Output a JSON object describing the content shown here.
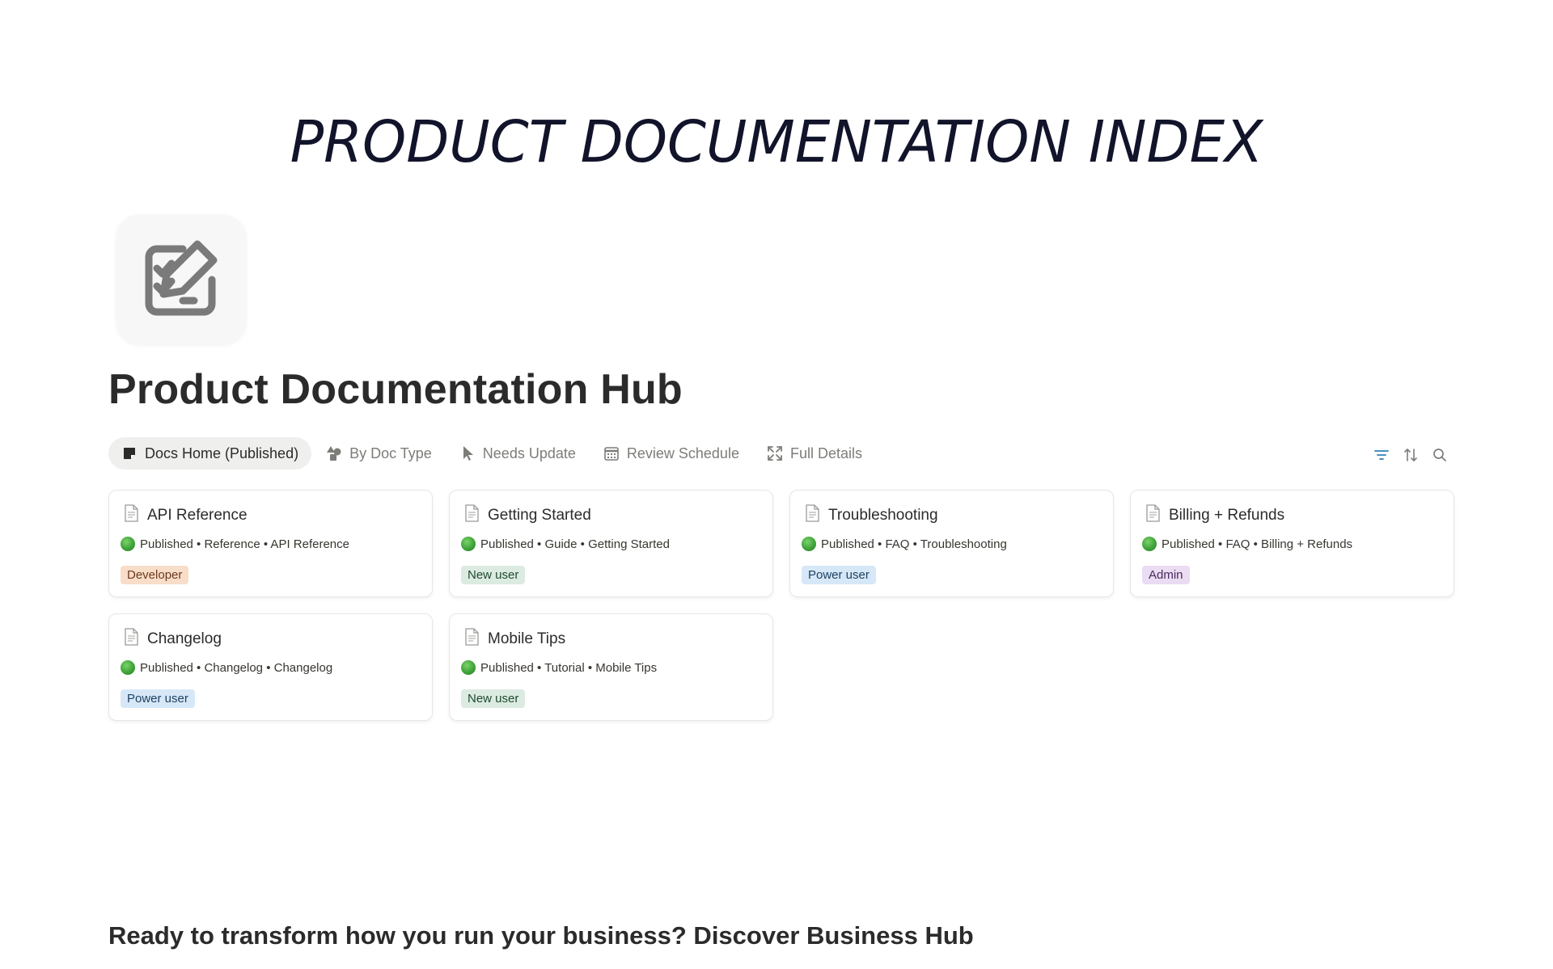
{
  "banner": {
    "text": "PRODUCT DOCUMENTATION INDEX"
  },
  "page": {
    "icon": "checklist-edit-icon",
    "title": "Product Documentation Hub"
  },
  "tabs": [
    {
      "label": "Docs Home (Published)",
      "icon": "note-icon",
      "active": true
    },
    {
      "label": "By Doc Type",
      "icon": "shapes-icon",
      "active": false
    },
    {
      "label": "Needs Update",
      "icon": "cursor-icon",
      "active": false
    },
    {
      "label": "Review Schedule",
      "icon": "calendar-icon",
      "active": false
    },
    {
      "label": "Full Details",
      "icon": "expand-icon",
      "active": false
    }
  ],
  "toolbar": {
    "filter": "filter-icon",
    "sort": "sort-icon",
    "search": "search-icon",
    "accent": "#2f80b8"
  },
  "cards": [
    {
      "title": "API Reference",
      "meta": "Published • Reference • API Reference",
      "tag": "Developer",
      "tag_bg": "#f8ddc9",
      "tag_fg": "#6b3b1d"
    },
    {
      "title": "Getting Started",
      "meta": "Published • Guide • Getting Started",
      "tag": "New user",
      "tag_bg": "#dcebe1",
      "tag_fg": "#1f4a2f"
    },
    {
      "title": "Troubleshooting",
      "meta": "Published • FAQ • Troubleshooting",
      "tag": "Power user",
      "tag_bg": "#d6e8f7",
      "tag_fg": "#1d3f5f"
    },
    {
      "title": "Billing + Refunds",
      "meta": "Published • FAQ • Billing + Refunds",
      "tag": "Admin",
      "tag_bg": "#eadcf2",
      "tag_fg": "#4b2a5e"
    },
    {
      "title": "Changelog",
      "meta": "Published • Changelog • Changelog",
      "tag": "Power user",
      "tag_bg": "#d6e8f7",
      "tag_fg": "#1d3f5f"
    },
    {
      "title": "Mobile Tips",
      "meta": "Published • Tutorial • Mobile Tips",
      "tag": "New user",
      "tag_bg": "#dcebe1",
      "tag_fg": "#1f4a2f"
    }
  ],
  "footer": {
    "heading": "Ready to transform how you run your business? Discover Business Hub",
    "paragraph": ""
  }
}
